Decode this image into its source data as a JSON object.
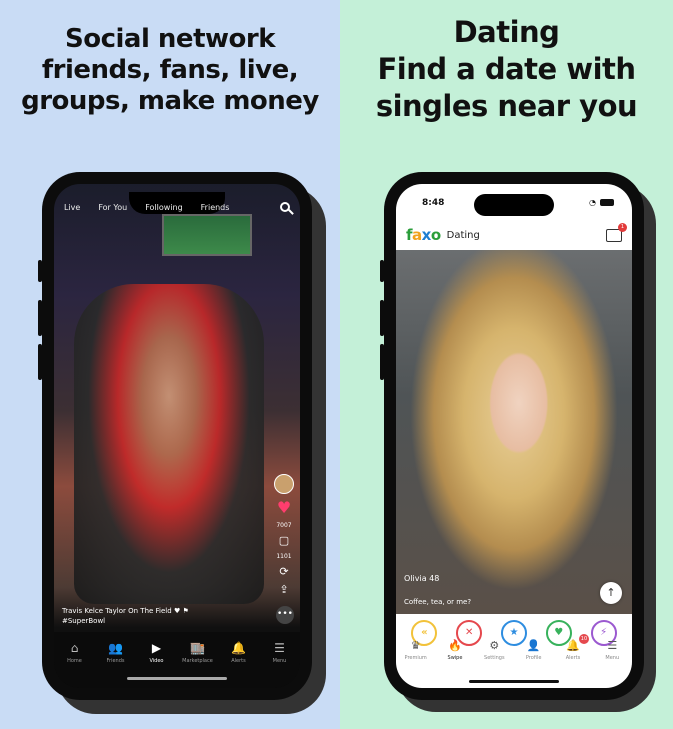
{
  "left_panel": {
    "headline_lines": [
      "Social network",
      "friends, fans, live,",
      "groups, make money"
    ],
    "top_tabs": [
      "Live",
      "For You",
      "Following",
      "Friends"
    ],
    "rail": {
      "like_count": "7007",
      "comment_count": "1101"
    },
    "caption_line1": "Travis Kelce Taylor On The Field",
    "caption_line2": "#SuperBowl",
    "more_label": "•••",
    "nav": [
      {
        "label": "Home",
        "icon": "⌂"
      },
      {
        "label": "Friends",
        "icon": "👥"
      },
      {
        "label": "Video",
        "icon": "▶"
      },
      {
        "label": "Marketplace",
        "icon": "🏬"
      },
      {
        "label": "Alerts",
        "icon": "🔔"
      },
      {
        "label": "Menu",
        "icon": "☰"
      }
    ]
  },
  "right_panel": {
    "headline_lines": [
      "Dating",
      "Find a date with",
      "singles near you"
    ],
    "status_time": "8:48",
    "app_title": "Dating",
    "chat_badge": "1",
    "profile_name": "Olivia 48",
    "profile_bio": "Coffee, tea, or me?",
    "actions": [
      "«",
      "✕",
      "★",
      "♥",
      "⚡"
    ],
    "nav": [
      {
        "label": "Premium",
        "icon": "♛"
      },
      {
        "label": "Swipe",
        "icon": "🔥"
      },
      {
        "label": "Settings",
        "icon": "⚙"
      },
      {
        "label": "Profile",
        "icon": "👤"
      },
      {
        "label": "Alerts",
        "icon": "🔔"
      },
      {
        "label": "Menu",
        "icon": "☰"
      }
    ],
    "alerts_badge": "10"
  },
  "colors": {
    "left_bg": "#c9dcf5",
    "right_bg": "#c4f0d8",
    "heart": "#ff3d6e",
    "nope": "#e5484d",
    "like": "#38b25c",
    "star": "#2e8de0"
  }
}
